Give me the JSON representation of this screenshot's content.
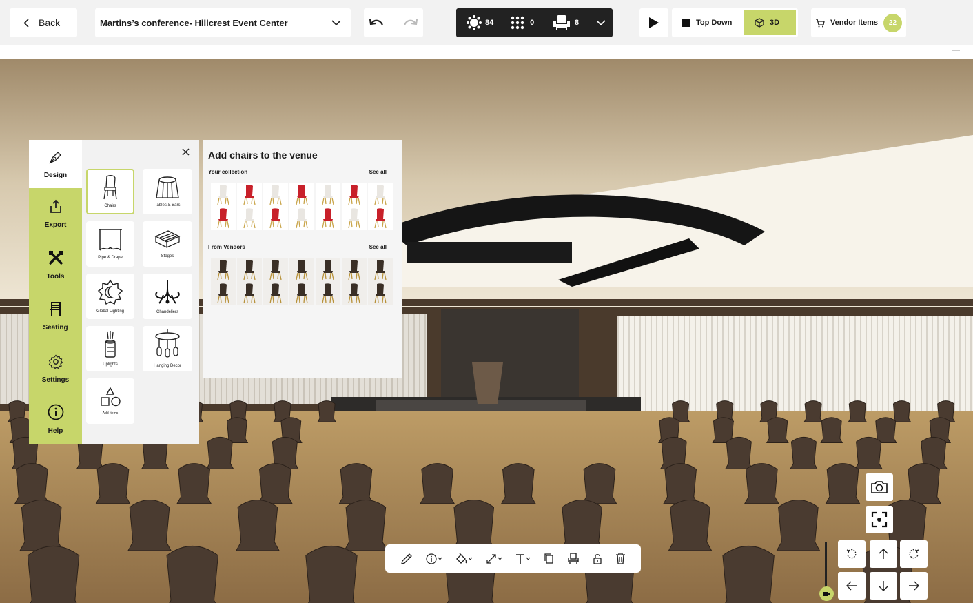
{
  "topbar": {
    "back_label": "Back",
    "event_name": "Martins’s conference- Hillcrest Event Center",
    "stats": [
      {
        "icon": "round-table-icon",
        "value": "84"
      },
      {
        "icon": "grid-dots-icon",
        "value": "0"
      },
      {
        "icon": "chair-icon",
        "value": "8"
      }
    ],
    "view_top_down": "Top Down",
    "view_3d": "3D",
    "vendor_items_label": "Vendor Items",
    "vendor_items_count": "22"
  },
  "sidebar": {
    "nav": [
      {
        "label": "Design",
        "icon": "pen-nib-icon",
        "active": true
      },
      {
        "label": "Export",
        "icon": "export-icon"
      },
      {
        "label": "Tools",
        "icon": "tools-icon"
      },
      {
        "label": "Seating",
        "icon": "seating-icon"
      },
      {
        "label": "Settings",
        "icon": "gear-icon"
      },
      {
        "label": "Help",
        "icon": "info-icon"
      }
    ],
    "items": [
      {
        "label": "Chairs",
        "icon": "chair-icon",
        "selected": true
      },
      {
        "label": "Tables & Bars",
        "icon": "table-icon"
      },
      {
        "label": "Pipe & Drape",
        "icon": "drape-icon"
      },
      {
        "label": "Stages",
        "icon": "stage-icon"
      },
      {
        "label": "Global Lighting",
        "icon": "lighting-icon"
      },
      {
        "label": "Chandeliers",
        "icon": "chandelier-icon"
      },
      {
        "label": "Uplights",
        "icon": "uplight-icon"
      },
      {
        "label": "Hanging Decor",
        "icon": "hanging-decor-icon"
      },
      {
        "label": "Add Items",
        "icon": "shapes-icon"
      }
    ]
  },
  "chair_panel": {
    "title": "Add chairs to the venue",
    "collection_label": "Your collection",
    "vendors_label": "From Vendors",
    "see_all": "See all",
    "collection_colors": [
      "white",
      "red",
      "white",
      "red",
      "white",
      "red",
      "white",
      "red",
      "white",
      "red",
      "white",
      "red",
      "white",
      "red"
    ],
    "vendor_count": 14
  },
  "colors": {
    "accent": "#c7d66a",
    "chair_red": "#c8202a",
    "dark": "#222222"
  }
}
